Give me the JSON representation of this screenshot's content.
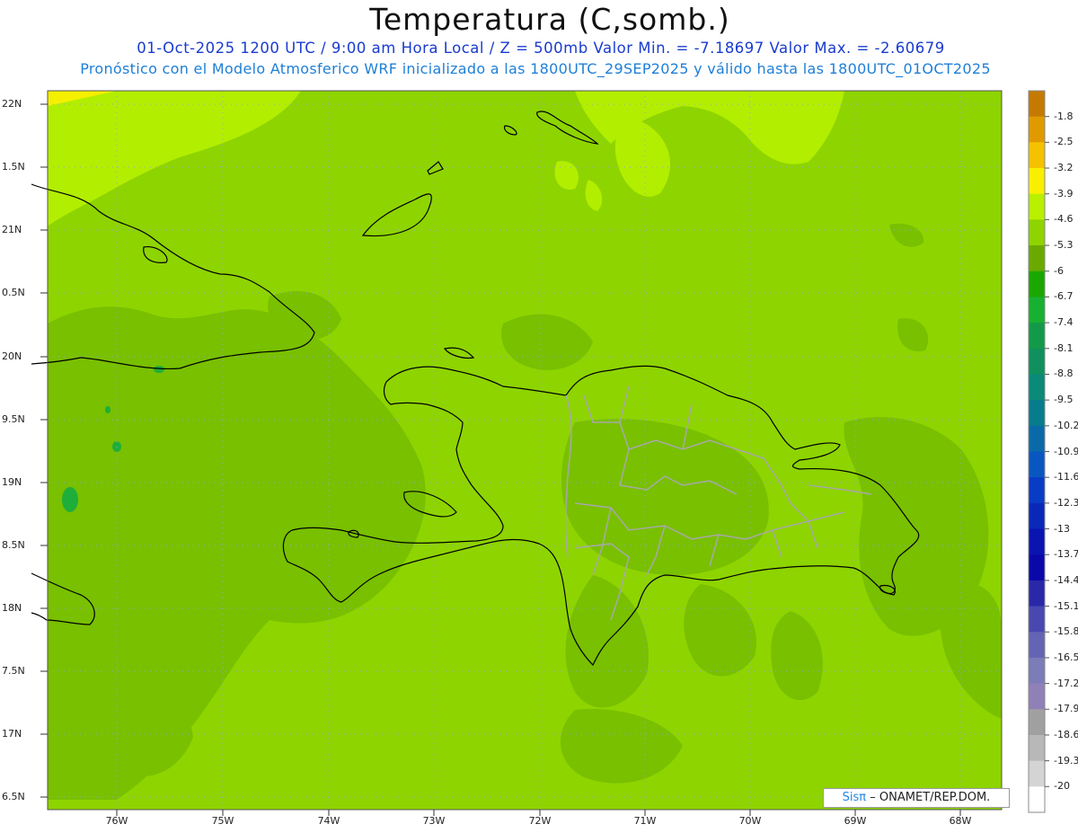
{
  "header": {
    "title": "Temperatura (C,somb.)",
    "line1": "01-Oct-2025  1200 UTC / 9:00 am Hora Local / Z = 500mb  Valor Min. = -7.18697  Valor Max. = -2.60679",
    "line2": "Pronóstico con el Modelo Atmosferico WRF inicializado a las 1800UTC_29SEP2025 y válido hasta las  1800UTC_01OCT2025"
  },
  "axes": {
    "lat_labels": [
      "22N",
      "1.5N",
      "21N",
      "0.5N",
      "20N",
      "9.5N",
      "19N",
      "8.5N",
      "18N",
      "7.5N",
      "17N",
      "6.5N"
    ],
    "lon_labels": [
      "76W",
      "75W",
      "74W",
      "73W",
      "72W",
      "71W",
      "70W",
      "69W",
      "68W"
    ]
  },
  "colorbar": {
    "labels": [
      "-1.8",
      "-2.5",
      "-3.2",
      "-3.9",
      "-4.6",
      "-5.3",
      "-6",
      "-6.7",
      "-7.4",
      "-8.1",
      "-8.8",
      "-9.5",
      "-10.2",
      "-10.9",
      "-11.6",
      "-12.3",
      "-13",
      "-13.7",
      "-14.4",
      "-15.1",
      "-15.8",
      "-16.5",
      "-17.2",
      "-17.9",
      "-18.6",
      "-19.3",
      "-20"
    ],
    "colors": [
      "#c47a00",
      "#e09a00",
      "#f5c200",
      "#f8f000",
      "#b8f000",
      "#8ed400",
      "#6aaa00",
      "#1aa800",
      "#18b030",
      "#139a48",
      "#10905e",
      "#0a8a78",
      "#087c8c",
      "#0a6aa8",
      "#0a56c0",
      "#083cc4",
      "#0a28b8",
      "#0a14b0",
      "#0a08a8",
      "#2a28a8",
      "#4848b0",
      "#6464b4",
      "#7c7cb8",
      "#9080b8",
      "#a0a0a0",
      "#b8b8b8",
      "#d4d4d4",
      "#ffffff"
    ]
  },
  "credit": {
    "sis": "Sisπ",
    "rest": "– ONAMET/REP.DOM."
  }
}
